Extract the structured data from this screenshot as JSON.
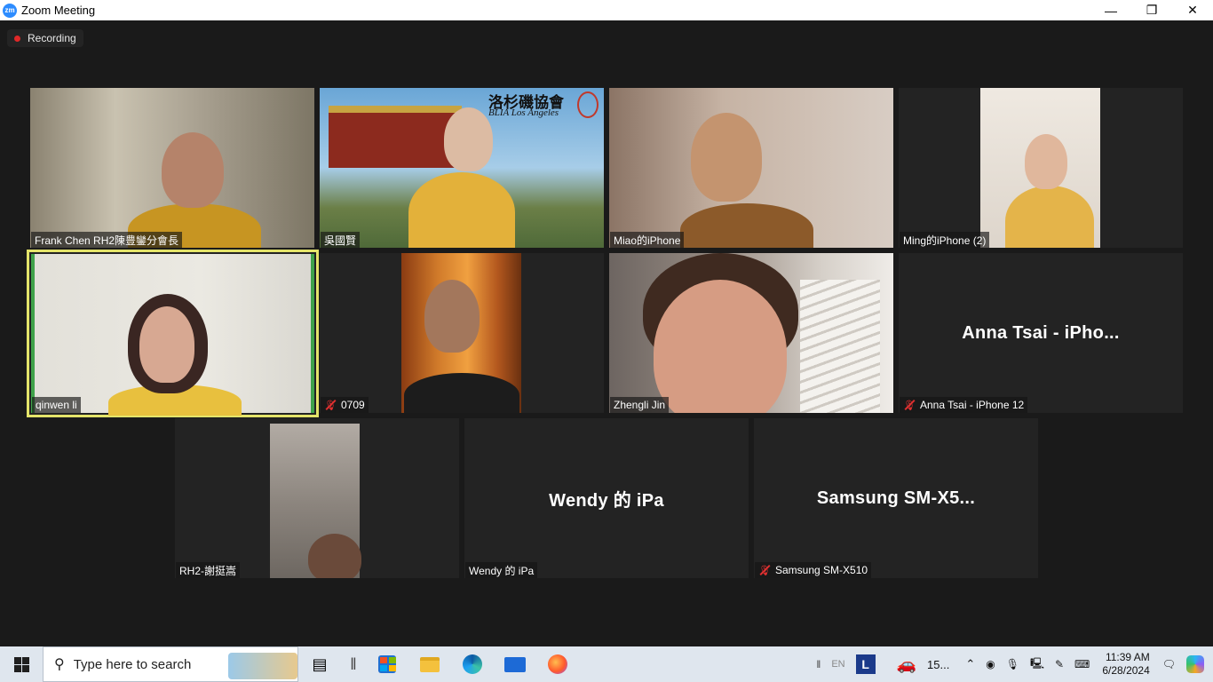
{
  "window": {
    "title": "Zoom Meeting",
    "logo_text": "zm",
    "controls": [
      "—",
      "❐",
      "✕"
    ]
  },
  "recording": {
    "label": "Recording"
  },
  "participants": [
    {
      "name": "Frank Chen RH2陳豊鑾分會長",
      "muted": false,
      "video": true
    },
    {
      "name": "吳國賢",
      "muted": false,
      "video": true,
      "banner_title": "洛杉磯協會",
      "banner_subtitle": "BLIA Los Angeles"
    },
    {
      "name": "Miao的iPhone",
      "muted": false,
      "video": true
    },
    {
      "name": "Ming的iPhone (2)",
      "muted": false,
      "video": true
    },
    {
      "name": "qinwen li",
      "muted": false,
      "video": true,
      "active_speaker": true
    },
    {
      "name": "0709",
      "muted": true,
      "video": true
    },
    {
      "name": "Zhengli Jin",
      "muted": false,
      "video": true
    },
    {
      "name": "Anna Tsai - iPhone 12",
      "muted": true,
      "video": false,
      "display_name": "Anna Tsai - iPho..."
    },
    {
      "name": "RH2-謝挺嵩",
      "muted": false,
      "video": true
    },
    {
      "name": "Wendy 的 iPa",
      "muted": false,
      "video": false,
      "display_name": "Wendy 的 iPa"
    },
    {
      "name": "Samsung SM-X510",
      "muted": true,
      "video": false,
      "display_name": "Samsung  SM-X5..."
    }
  ],
  "taskbar": {
    "search_placeholder": "Type here to search",
    "lang": "EN",
    "notification_text": "15...",
    "time": "11:39 AM",
    "date": "6/28/2024",
    "apps": [
      "task-view",
      "microsoft-store",
      "file-explorer",
      "edge",
      "mail",
      "firefox"
    ],
    "pinned_app_letter": "L"
  },
  "colors": {
    "background": "#1a1a1a",
    "tile": "#232323",
    "active_speaker_border": "#e4e46a",
    "recording_dot": "#e02828",
    "mute_red": "#e03030",
    "zoom_blue": "#2d8cff"
  }
}
